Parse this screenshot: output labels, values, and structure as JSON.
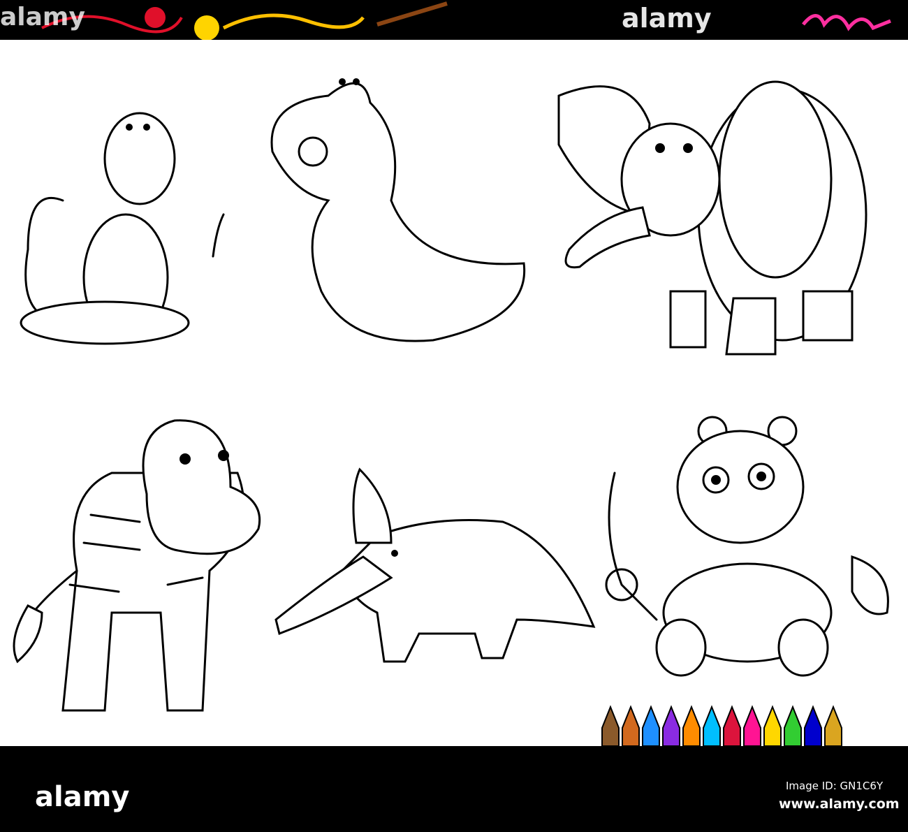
{
  "watermark": {
    "top_logo": "alamy",
    "bottom_logo": "alamy"
  },
  "footer": {
    "image_id": "Image ID: GN1C6Y",
    "site": "www.alamy.com"
  },
  "illustration": {
    "animals": [
      "monkey",
      "crocodile",
      "elephant",
      "zebra",
      "aardvark",
      "panda"
    ],
    "pencil_colors": [
      "#8b5a2b",
      "#d2691e",
      "#1e90ff",
      "#8a2be2",
      "#ff8c00",
      "#00bfff",
      "#dc143c",
      "#ff1493",
      "#ffd700",
      "#32cd32",
      "#0000cd",
      "#daa520"
    ]
  }
}
